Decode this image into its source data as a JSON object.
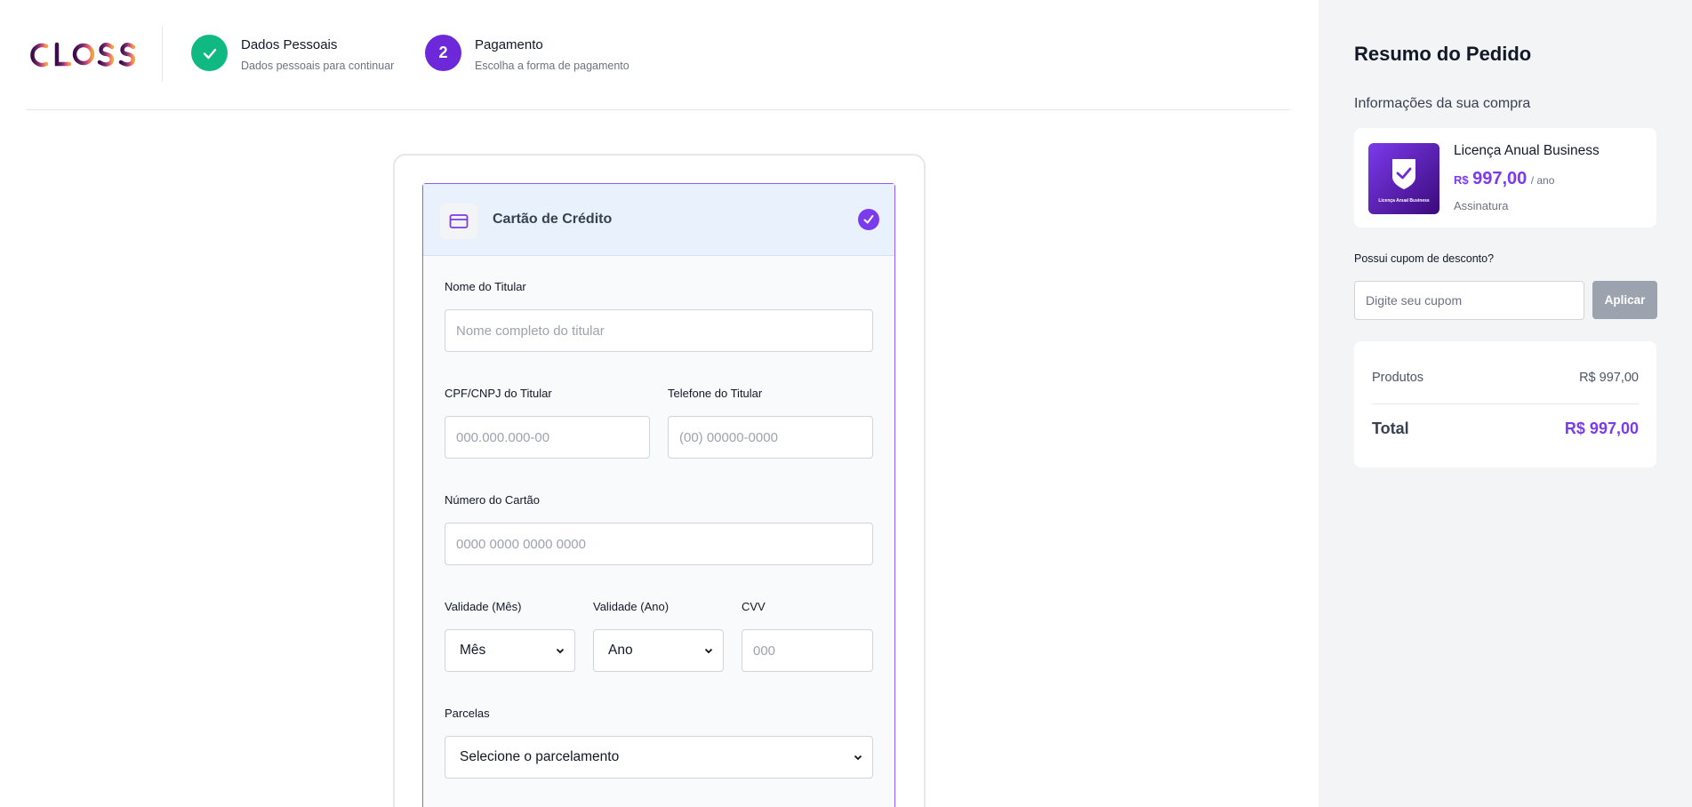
{
  "brand": {
    "logo_text": "CLOSS"
  },
  "steps": [
    {
      "title": "Dados Pessoais",
      "subtitle": "Dados pessoais para continuar",
      "state": "completed",
      "color": "#10b981"
    },
    {
      "title": "Pagamento",
      "subtitle": "Escolha a forma de pagamento",
      "number": "2",
      "state": "active",
      "color": "#6d28d9"
    }
  ],
  "payment": {
    "method_title": "Cartão de Crédito",
    "fields": {
      "holder_name": {
        "label": "Nome do Titular",
        "placeholder": "Nome completo do titular"
      },
      "holder_doc": {
        "label": "CPF/CNPJ do Titular",
        "placeholder": "000.000.000-00"
      },
      "holder_phone": {
        "label": "Telefone do Titular",
        "placeholder": "(00) 00000-0000"
      },
      "card_number": {
        "label": "Número do Cartão",
        "placeholder": "0000 0000 0000 0000"
      },
      "exp_month": {
        "label": "Validade (Mês)",
        "value": "Mês"
      },
      "exp_year": {
        "label": "Validade (Ano)",
        "value": "Ano"
      },
      "cvv": {
        "label": "CVV",
        "placeholder": "000"
      },
      "installments": {
        "label": "Parcelas",
        "value": "Selecione o parcelamento"
      }
    }
  },
  "summary": {
    "title": "Resumo do Pedido",
    "subtitle": "Informações da sua compra",
    "product": {
      "name": "Licença Anual Business",
      "currency": "R$",
      "price": "997,00",
      "period": "/ ano",
      "type": "Assinatura",
      "image_caption": "Licença Anual Business"
    },
    "coupon": {
      "label": "Possui cupom de desconto?",
      "placeholder": "Digite seu cupom",
      "button": "Aplicar"
    },
    "products_label": "Produtos",
    "products_value": "R$ 997,00",
    "total_label": "Total",
    "total_value": "R$ 997,00"
  },
  "colors": {
    "accent": "#7c3aed",
    "success": "#10b981",
    "sidebar_bg": "#f3f4f6"
  }
}
